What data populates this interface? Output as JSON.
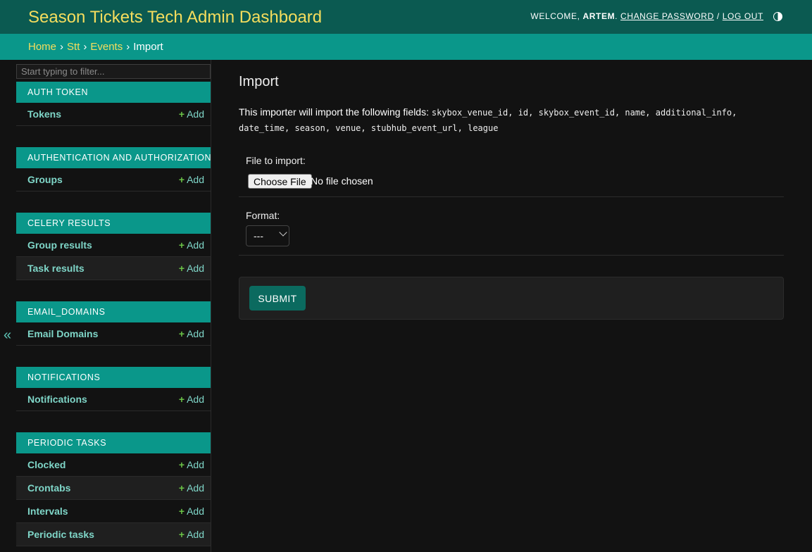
{
  "header": {
    "site_name": "Season Tickets Tech Admin Dashboard",
    "welcome": "WELCOME,",
    "username": "ARTEM",
    "change_password": "CHANGE PASSWORD",
    "separator": "/",
    "log_out": "LOG OUT",
    "theme_icon": "contrast-icon"
  },
  "breadcrumbs": {
    "items": [
      "Home",
      "Stt",
      "Events"
    ],
    "current": "Import",
    "arrow": "›"
  },
  "sidebar": {
    "filter_placeholder": "Start typing to filter...",
    "collapse_icon": "«",
    "add_label": "Add",
    "modules": [
      {
        "caption": "AUTH TOKEN",
        "models": [
          "Tokens"
        ]
      },
      {
        "caption": "AUTHENTICATION AND AUTHORIZATION",
        "models": [
          "Groups"
        ]
      },
      {
        "caption": "CELERY RESULTS",
        "models": [
          "Group results",
          "Task results"
        ]
      },
      {
        "caption": "EMAIL_DOMAINS",
        "models": [
          "Email Domains"
        ]
      },
      {
        "caption": "NOTIFICATIONS",
        "models": [
          "Notifications"
        ]
      },
      {
        "caption": "PERIODIC TASKS",
        "models": [
          "Clocked",
          "Crontabs",
          "Intervals",
          "Periodic tasks"
        ]
      }
    ]
  },
  "main": {
    "title": "Import",
    "intro_text": "This importer will import the following fields:",
    "fields_line1": "skybox_venue_id, id, skybox_event_id, name, additional_info,",
    "fields_line2": "date_time, season, venue, stubhub_event_url, league",
    "file_label": "File to import:",
    "choose_file": "Choose File",
    "no_file": "No file chosen",
    "format_label": "Format:",
    "format_value": "---",
    "submit": "SUBMIT"
  },
  "colors": {
    "header_bg": "#0b5a51",
    "breadcrumb_bg": "#0a978a",
    "site_name": "#f5dd5d",
    "link": "#7fd6c8",
    "add_plus": "#6ac246",
    "submit_bg": "#0b6a5f"
  }
}
